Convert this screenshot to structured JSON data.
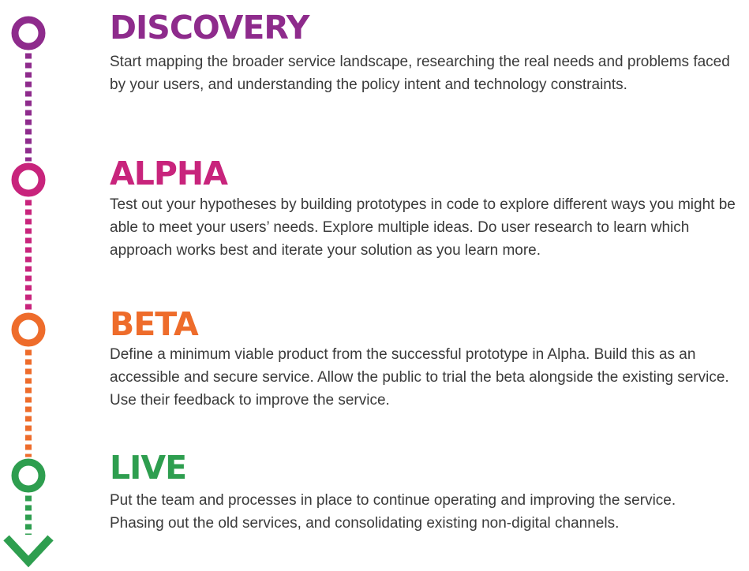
{
  "phases": [
    {
      "title": "DISCOVERY",
      "color": "#8e2b8c",
      "description": "Start mapping the broader service landscape, researching the real needs and problems faced by your users, and understanding the policy intent and technology constraints."
    },
    {
      "title": "ALPHA",
      "color": "#c8247c",
      "description": "Test out your hypotheses by building prototypes in code to explore different ways you might be able to meet your users’ needs. Explore multiple ideas. Do user research to learn which approach works best and iterate your solution as you learn more."
    },
    {
      "title": "BETA",
      "color": "#ee6c2b",
      "description": "Define a minimum viable product from the successful prototype in Alpha. Build this as an accessible and secure service. Allow the public to trial the beta alongside the existing service. Use their feedback to improve the service."
    },
    {
      "title": "LIVE",
      "color": "#2e9e4f",
      "description": "Put the team and processes in place to continue operating and improving the service. Phasing out the old services, and consolidating existing non-digital channels."
    }
  ],
  "timeline": {
    "arrow_icon": "arrow-down-icon",
    "node_icon": "ring-icon"
  }
}
